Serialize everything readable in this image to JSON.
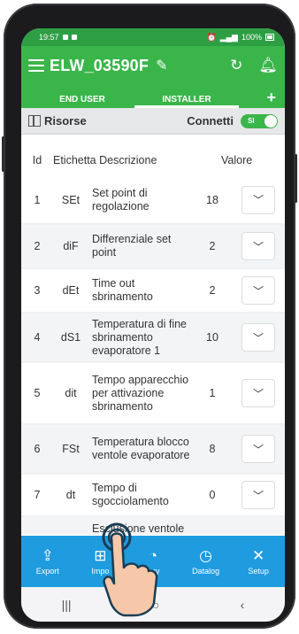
{
  "status_bar": {
    "time": "19:57",
    "battery": "100%"
  },
  "app_bar": {
    "device_name": "ELW_03590F"
  },
  "tabs": [
    {
      "label": "END USER",
      "active": false
    },
    {
      "label": "INSTALLER",
      "active": true
    }
  ],
  "tab_add": "+",
  "subbar": {
    "resources_label": "Risorse",
    "connect_label": "Connetti",
    "toggle_value": "SI"
  },
  "table": {
    "headers": {
      "id": "Id",
      "label_description": "Etichetta Descrizione",
      "value": "Valore"
    },
    "rows": [
      {
        "id": "1",
        "label": "SEt",
        "description": "Set point di regolazione",
        "value": "18"
      },
      {
        "id": "2",
        "label": "diF",
        "description": "Differenziale set point",
        "value": "2"
      },
      {
        "id": "3",
        "label": "dEt",
        "description": "Time out sbrinamento",
        "value": "2"
      },
      {
        "id": "4",
        "label": "dS1",
        "description": "Temperatura di fine sbrinamento evaporatore 1",
        "value": "10"
      },
      {
        "id": "5",
        "label": "dit",
        "description": "Tempo apparecchio per attivazione sbrinamento",
        "value": "1"
      },
      {
        "id": "6",
        "label": "FSt",
        "description": "Temperatura blocco ventole evaporatore",
        "value": "8"
      },
      {
        "id": "7",
        "label": "dt",
        "description": "Tempo di sgocciolamento",
        "value": "0"
      },
      {
        "id": "",
        "label": "",
        "description": "Esclusione ventole",
        "value": ""
      }
    ]
  },
  "bottom_nav": [
    {
      "label": "Export",
      "icon": "export-icon"
    },
    {
      "label": "Impo",
      "icon": "import-icon"
    },
    {
      "label": "tory",
      "icon": "history-icon"
    },
    {
      "label": "Datalog",
      "icon": "datalog-icon"
    },
    {
      "label": "Setup",
      "icon": "setup-icon"
    }
  ],
  "colors": {
    "app_green": "#3ab54a",
    "status_green": "#2e9e44",
    "nav_blue": "#1f9be0"
  }
}
